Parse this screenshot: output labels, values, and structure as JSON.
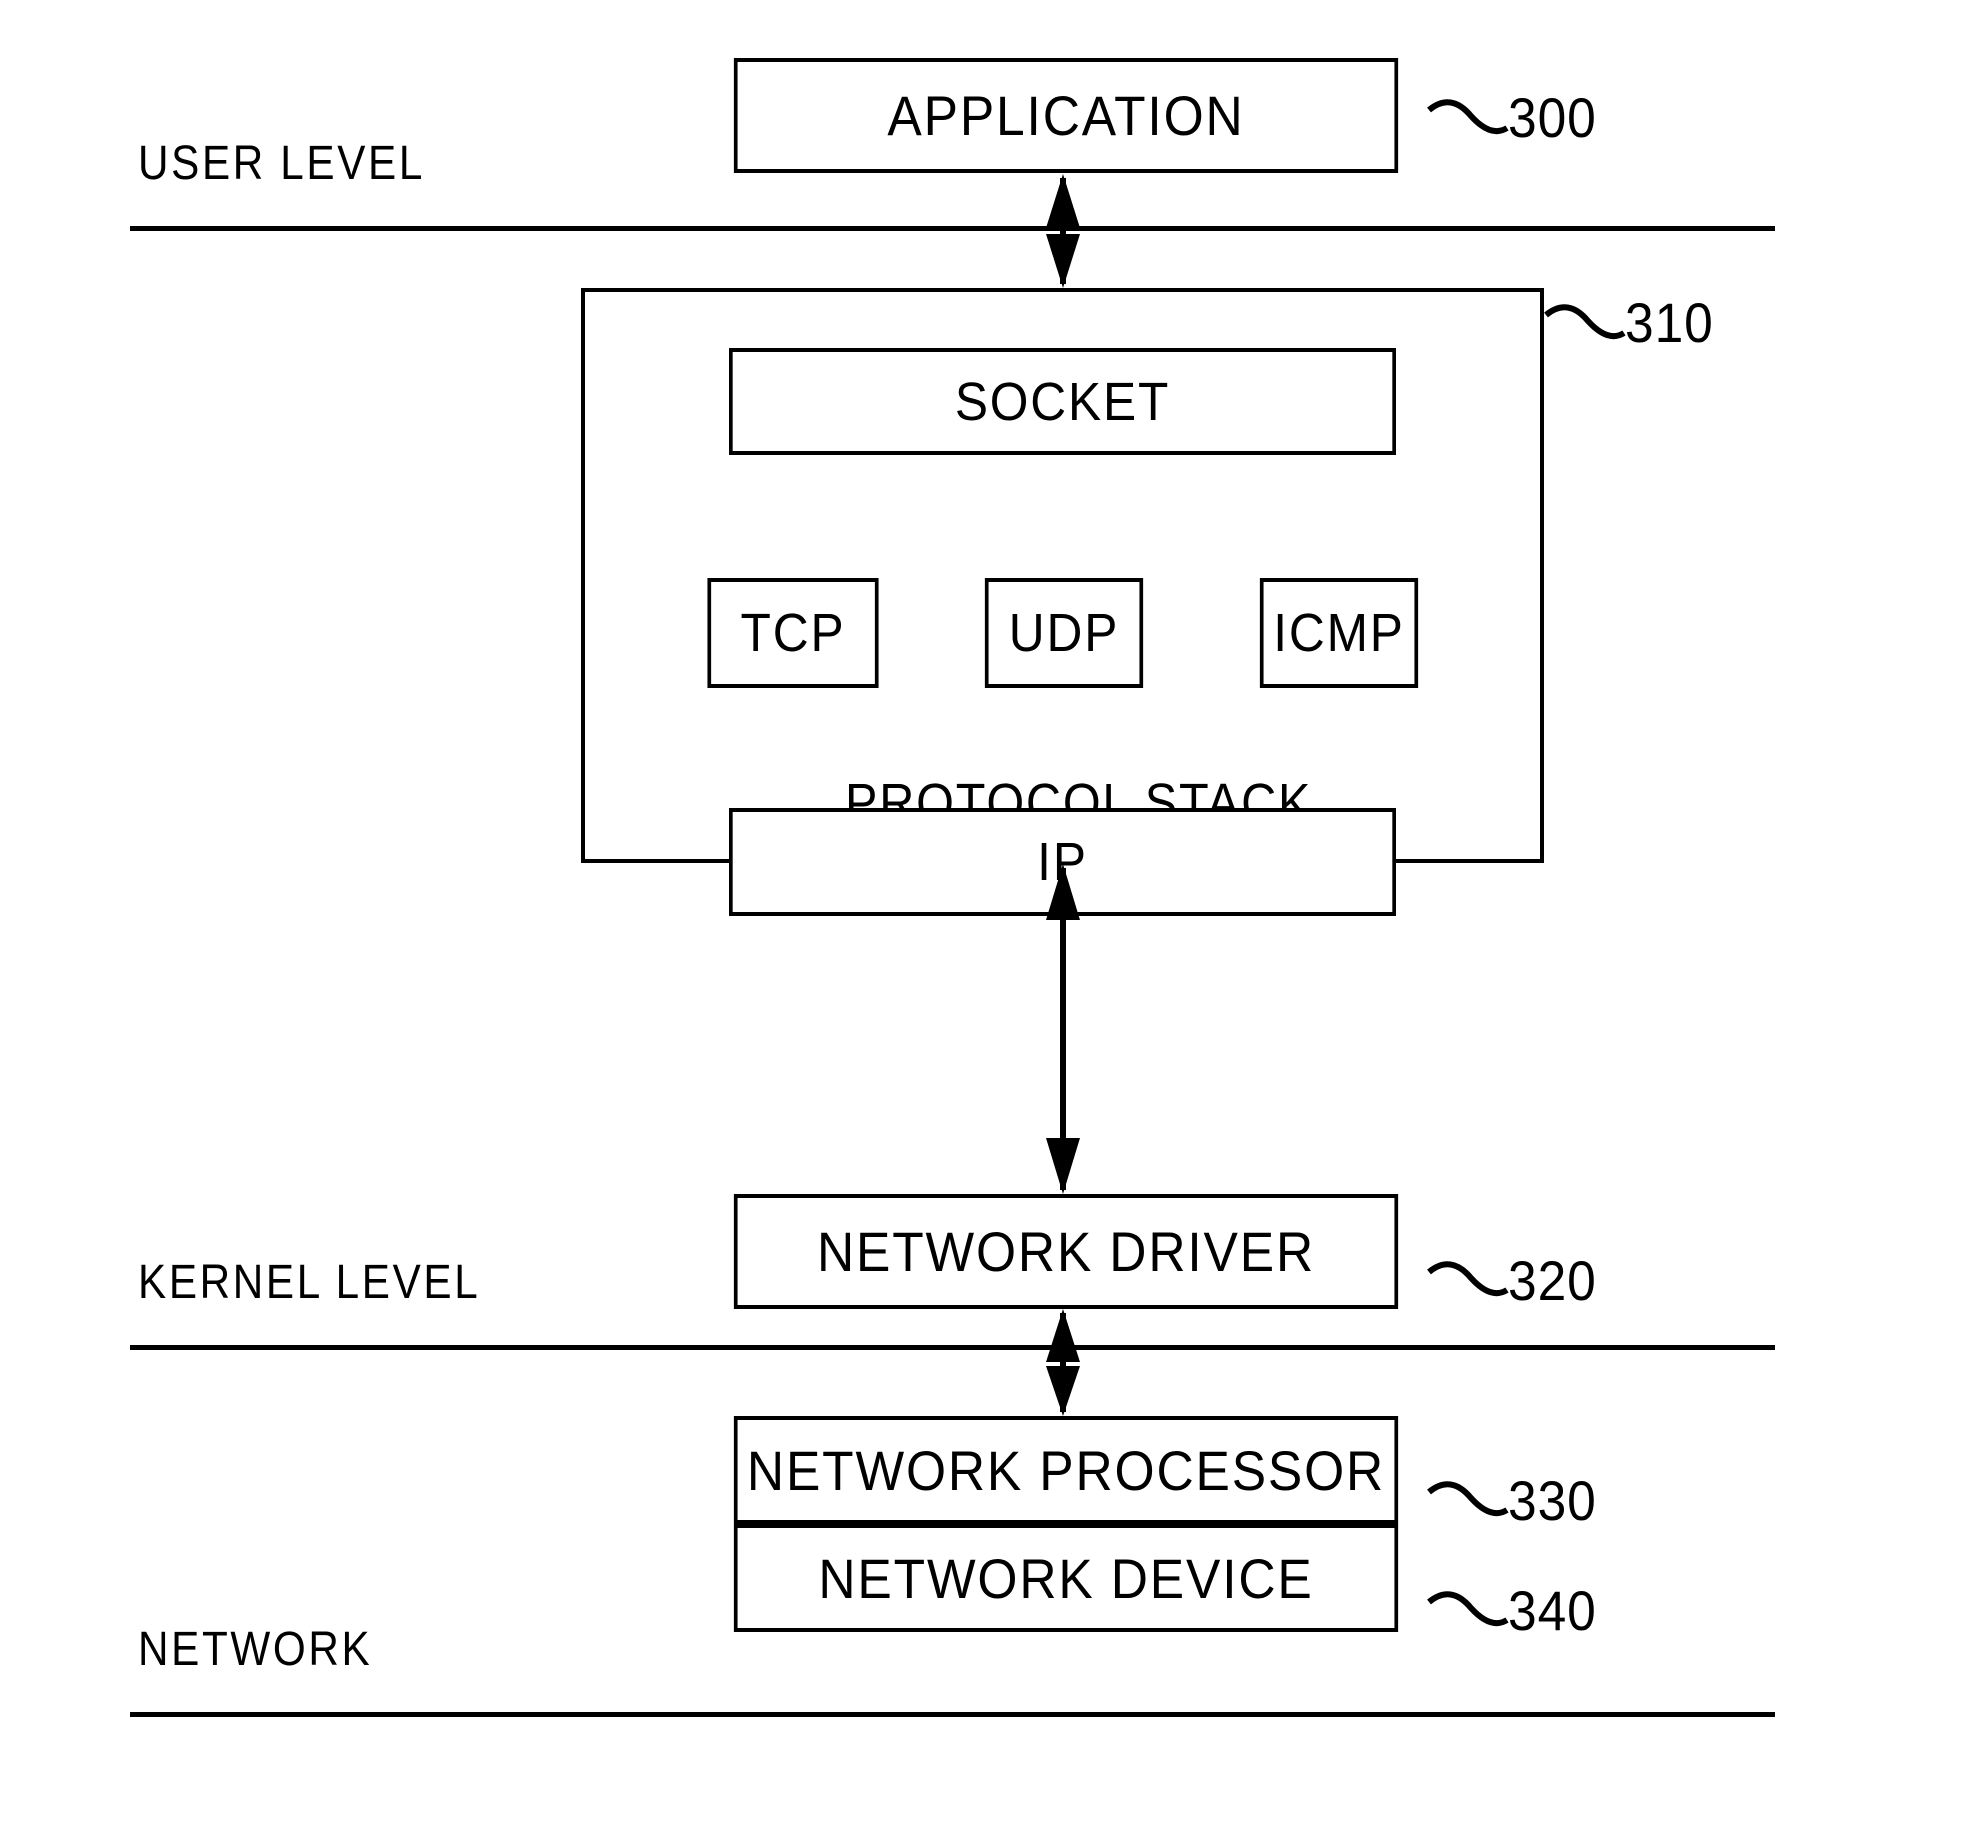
{
  "figure": {
    "type": "patent-block-diagram",
    "background": "#ffffff",
    "stroke_color": "#000000"
  },
  "levels": [
    {
      "id": "user-level",
      "label": "USER LEVEL"
    },
    {
      "id": "kernel-level",
      "label": "KERNEL LEVEL"
    },
    {
      "id": "network-level",
      "label": "NETWORK"
    }
  ],
  "blocks": {
    "application": {
      "label": "APPLICATION",
      "ref": "300"
    },
    "protocol_stack": {
      "label": "PROTOCOL  STACK",
      "ref": "310"
    },
    "socket": {
      "label": "SOCKET"
    },
    "tcp": {
      "label": "TCP"
    },
    "udp": {
      "label": "UDP"
    },
    "icmp": {
      "label": "ICMP"
    },
    "ip": {
      "label": "IP"
    },
    "network_driver": {
      "label": "NETWORK DRIVER",
      "ref": "320"
    },
    "network_processor": {
      "label": "NETWORK PROCESSOR",
      "ref": "330"
    },
    "network_device": {
      "label": "NETWORK DEVICE",
      "ref": "340"
    }
  },
  "connectors": [
    {
      "id": "application-to-protocol-stack",
      "style": "double-headed-vertical-arrow"
    },
    {
      "id": "protocol-stack-to-network-driver",
      "style": "double-headed-vertical-arrow"
    },
    {
      "id": "network-driver-to-network-processor",
      "style": "double-headed-vertical-arrow"
    }
  ]
}
